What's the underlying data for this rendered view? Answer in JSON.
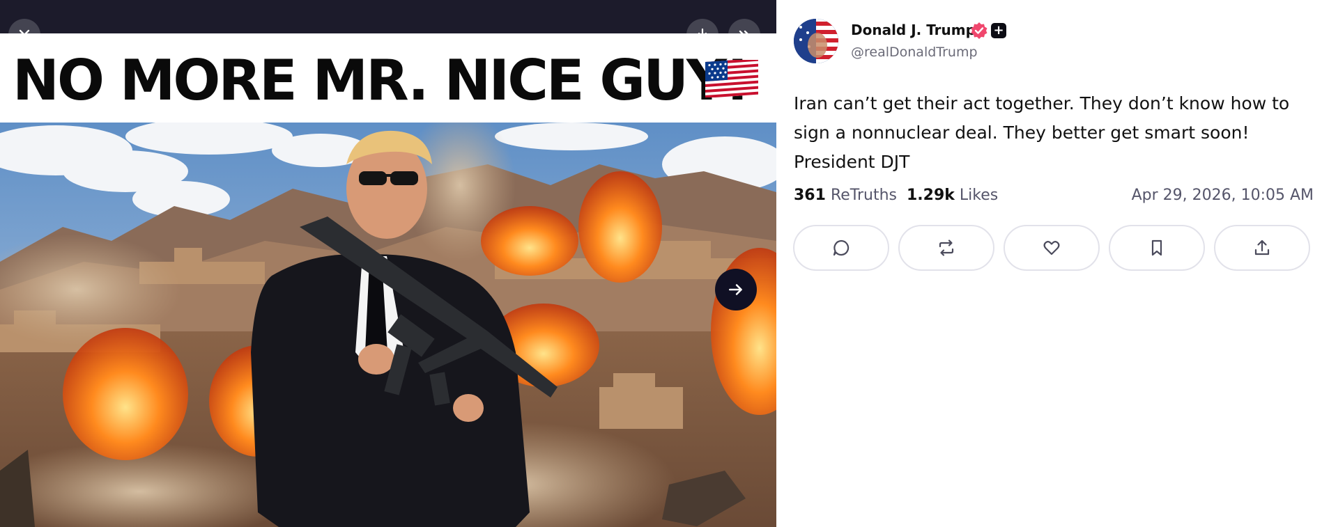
{
  "media": {
    "headline": "NO MORE MR. NICE GUY! 🇺🇸",
    "headline_text": "NO MORE MR. NICE GUY!",
    "buttons": {
      "close_icon": "close-icon",
      "download_icon": "download-icon",
      "forward_icon": "double-chevron-right-icon",
      "next_icon": "arrow-right-icon"
    },
    "colors": {
      "topbar": "#1c1b2b",
      "next_button": "#101024"
    }
  },
  "post": {
    "author": {
      "name": "Donald J. Trump",
      "handle": "@realDonaldTrump",
      "badges": [
        "verified-badge-icon",
        "plus-badge-icon"
      ],
      "badge_plus_label": "+"
    },
    "body": "Iran can’t get their act together. They don’t know how to sign a nonnuclear deal. They better get smart soon! President DJT",
    "stats": {
      "retruths_count": "361",
      "retruths_label": "ReTruths",
      "likes_count": "1.29k",
      "likes_label": "Likes"
    },
    "timestamp": "Apr 29, 2026, 10:05 AM",
    "actions": [
      "reply-icon",
      "retruth-icon",
      "like-icon",
      "bookmark-icon",
      "share-icon"
    ],
    "colors": {
      "verified": "#f0476d",
      "muted_text": "#55556a",
      "border": "#e2e2ea"
    }
  }
}
